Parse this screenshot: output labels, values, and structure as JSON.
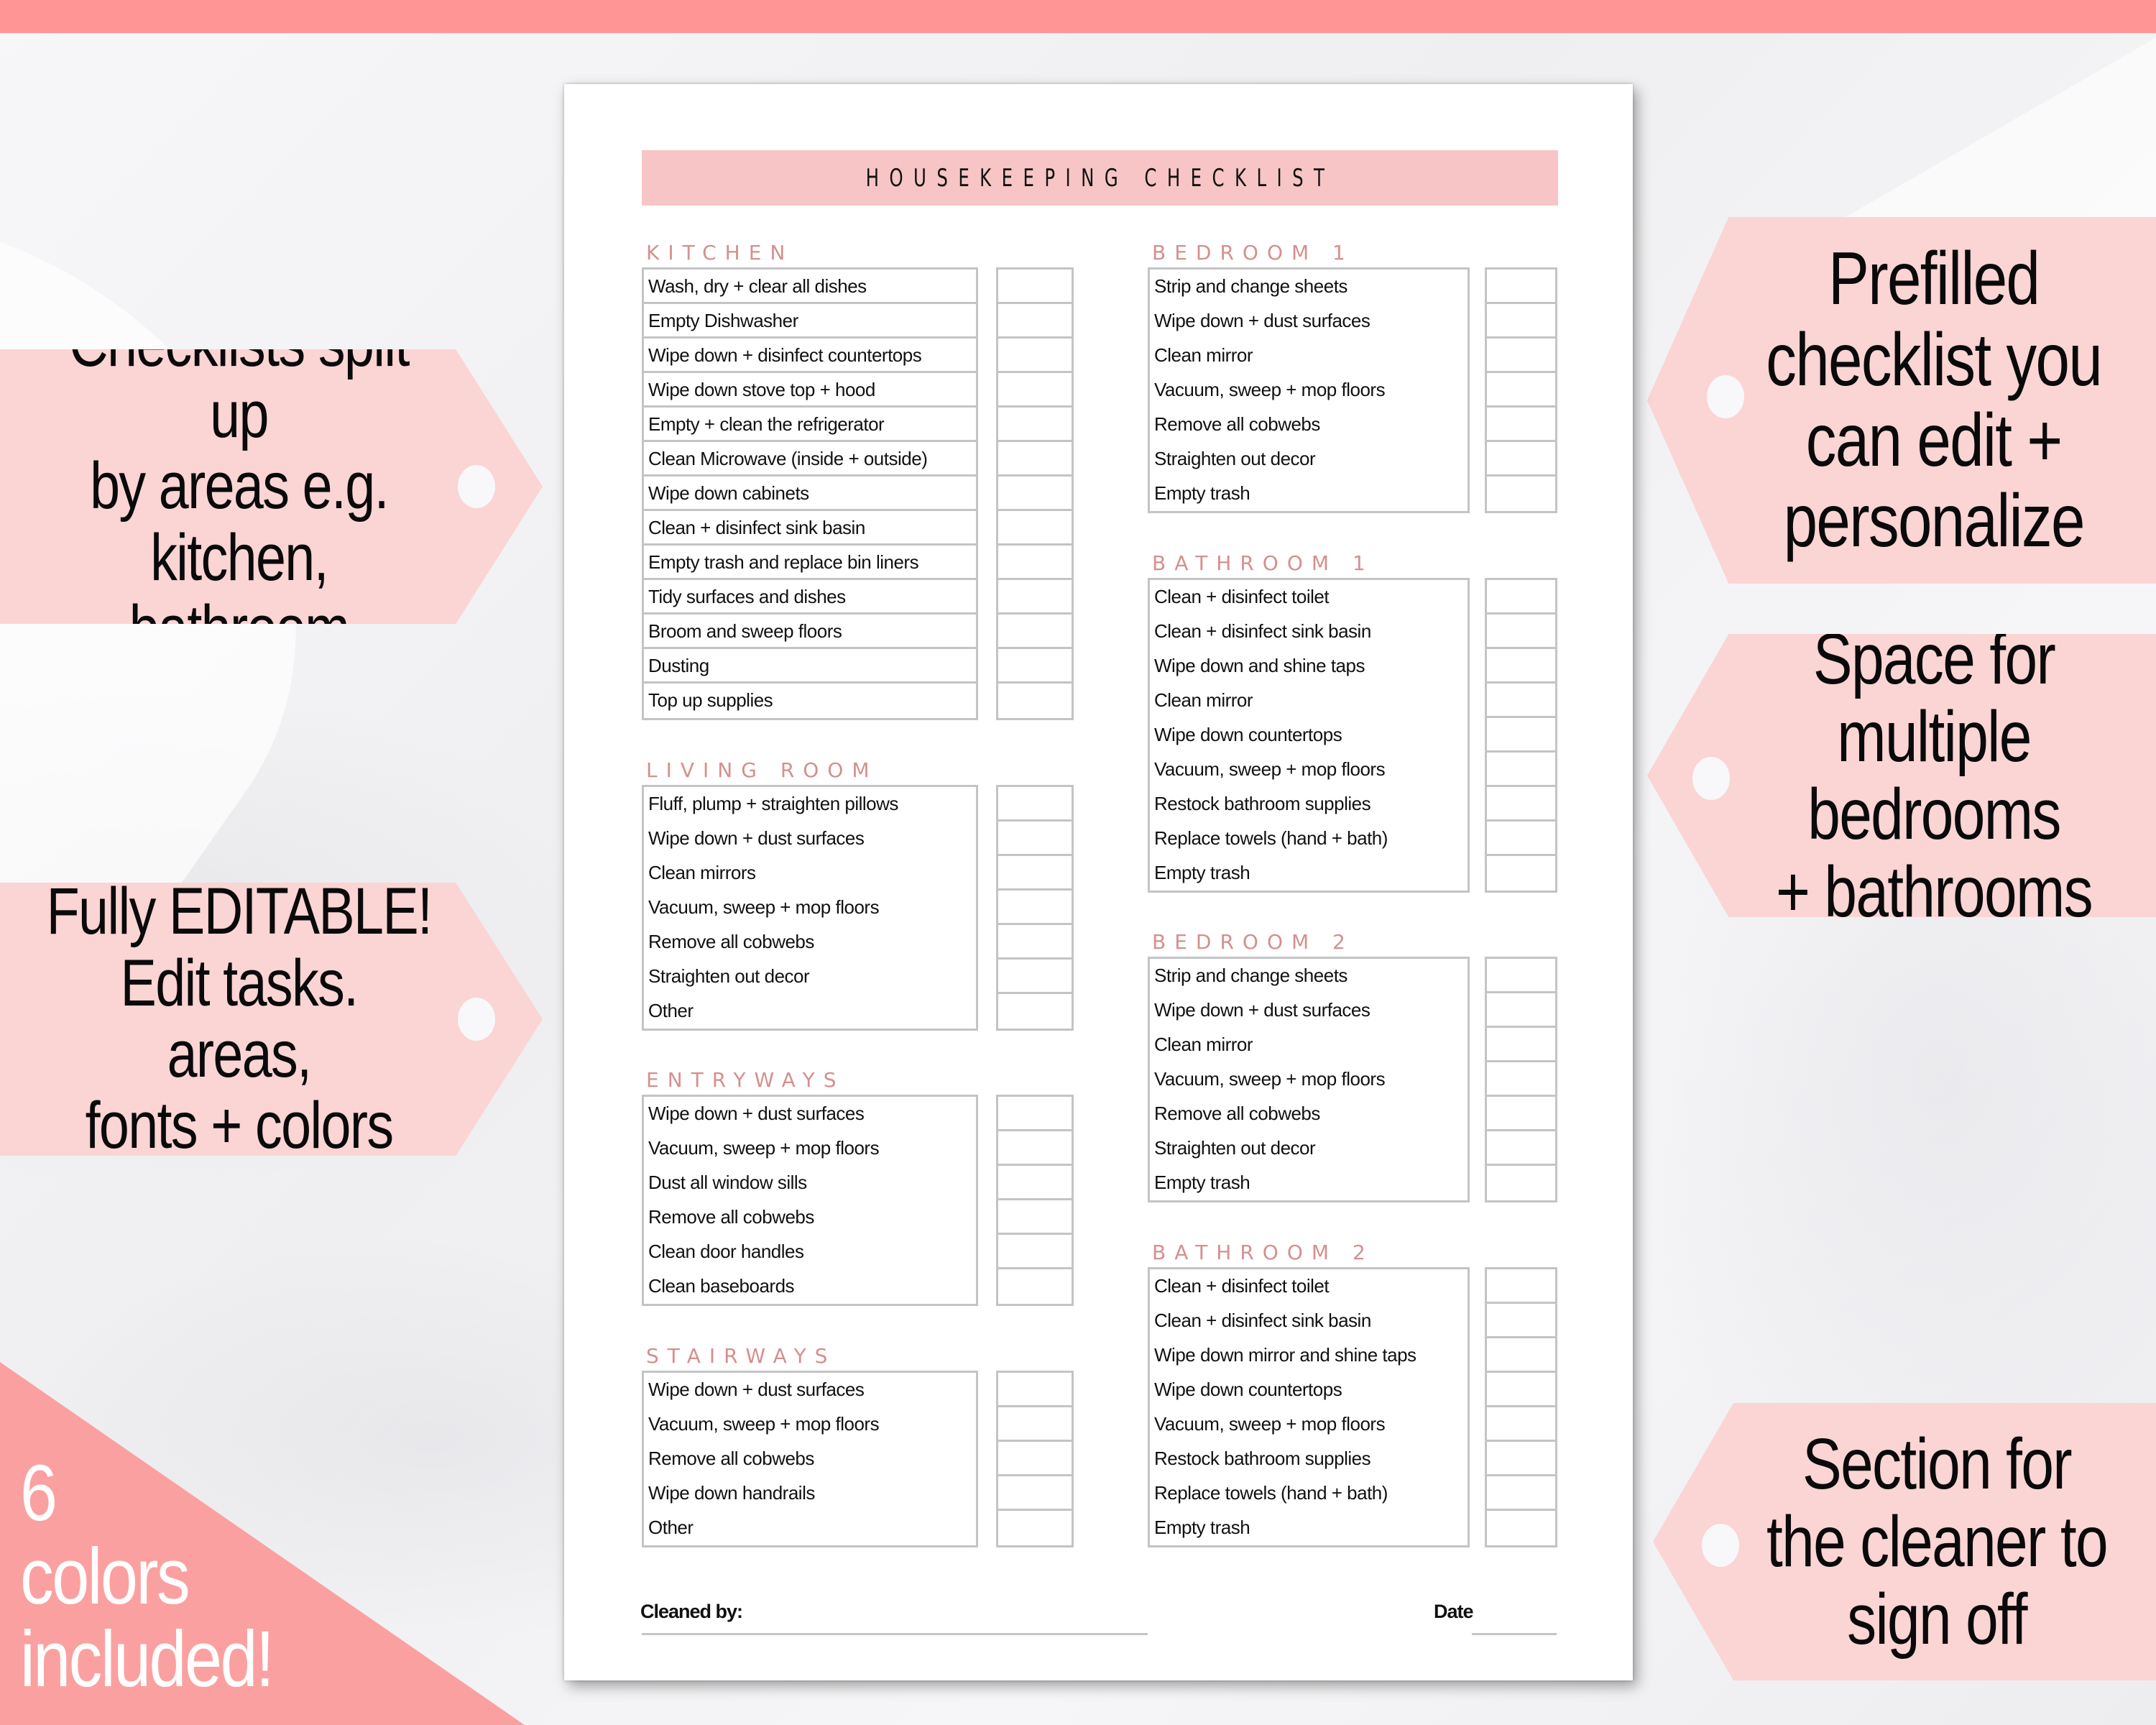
{
  "colors": {
    "top_bar": "#ff9595",
    "banner": "#f7c5c5",
    "section_title": "#d58f8f",
    "tag": "#fbd4d4",
    "corner_badge": "#fba0a0",
    "grid_line": "#c4c4c4"
  },
  "document": {
    "title": "HOUSEKEEPING CHECKLIST",
    "sections": [
      {
        "title": "KITCHEN",
        "items": [
          "Wash, dry + clear all dishes",
          "Empty Dishwasher",
          "Wipe down + disinfect countertops",
          "Wipe down stove top + hood",
          "Empty + clean the refrigerator",
          "Clean Microwave (inside + outside)",
          "Wipe down cabinets",
          "Clean + disinfect sink basin",
          "Empty trash and replace bin liners",
          "Tidy surfaces and dishes",
          "Broom and sweep floors",
          "Dusting",
          "Top up supplies"
        ]
      },
      {
        "title": "LIVING ROOM",
        "items": [
          "Fluff, plump + straighten pillows",
          "Wipe down + dust surfaces",
          "Clean mirrors",
          "Vacuum, sweep + mop floors",
          "Remove all cobwebs",
          "Straighten out decor",
          "Other"
        ]
      },
      {
        "title": "ENTRYWAYS",
        "items": [
          "Wipe down + dust surfaces",
          "Vacuum, sweep + mop floors",
          "Dust all window sills",
          "Remove all cobwebs",
          "Clean door handles",
          "Clean baseboards"
        ]
      },
      {
        "title": "STAIRWAYS",
        "items": [
          "Wipe down + dust surfaces",
          "Vacuum, sweep + mop floors",
          "Remove all cobwebs",
          "Wipe down handrails",
          "Other"
        ]
      },
      {
        "title": "BEDROOM 1",
        "items": [
          "Strip and change sheets",
          "Wipe down + dust surfaces",
          "Clean mirror",
          "Vacuum, sweep + mop floors",
          "Remove all cobwebs",
          "Straighten out decor",
          "Empty trash"
        ]
      },
      {
        "title": "BATHROOM 1",
        "items": [
          "Clean + disinfect toilet",
          "Clean + disinfect sink basin",
          "Wipe down and shine taps",
          "Clean mirror",
          "Wipe down countertops",
          "Vacuum, sweep + mop floors",
          "Restock bathroom supplies",
          "Replace towels (hand + bath)",
          "Empty trash"
        ]
      },
      {
        "title": "BEDROOM 2",
        "items": [
          "Strip and change sheets",
          "Wipe down + dust surfaces",
          "Clean mirror",
          "Vacuum, sweep + mop floors",
          "Remove all cobwebs",
          "Straighten out decor",
          "Empty trash"
        ]
      },
      {
        "title": "BATHROOM 2",
        "items": [
          "Clean + disinfect toilet",
          "Clean + disinfect sink basin",
          "Wipe down mirror and shine taps",
          "Wipe down countertops",
          "Vacuum, sweep + mop floors",
          "Restock bathroom supplies",
          "Replace towels (hand + bath)",
          "Empty trash"
        ]
      }
    ],
    "footer": {
      "cleaned_by_label": "Cleaned by:",
      "cleaned_by_value": "",
      "date_label": "Date",
      "date_value": ""
    }
  },
  "promo": {
    "left_tags": [
      {
        "text": "Checklists split up\nby areas e.g.\nkitchen, bathroom"
      },
      {
        "text": "Fully EDITABLE!\nEdit tasks. areas,\nfonts + colors"
      }
    ],
    "right_tags": [
      {
        "text": "Prefilled\nchecklist you\ncan edit +\npersonalize"
      },
      {
        "text": "Space for\nmultiple bedrooms\n+ bathrooms"
      },
      {
        "text": "Section for\nthe cleaner to\nsign off"
      }
    ],
    "corner_badge": "6\ncolors\nincluded!"
  }
}
